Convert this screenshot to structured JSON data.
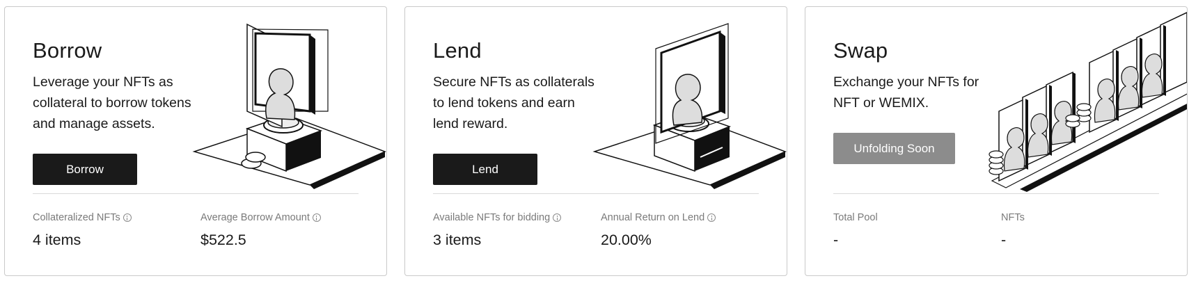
{
  "cards": [
    {
      "title": "Borrow",
      "description": "Leverage your NFTs as\ncollateral to borrow tokens\nand manage assets.",
      "button": "Borrow",
      "stats": [
        {
          "label": "Collateralized NFTs",
          "value": "4 items",
          "info_icon": "info-icon"
        },
        {
          "label": "Average Borrow Amount",
          "value": "$522.5",
          "info_icon": "info-icon"
        }
      ],
      "illustration": "nft-frame-pedestal-illustration"
    },
    {
      "title": "Lend",
      "description": "Secure NFTs as collaterals\nto lend tokens and earn\nlend reward.",
      "button": "Lend",
      "stats": [
        {
          "label": "Available NFTs for bidding",
          "value": "3 items",
          "info_icon": "info-icon"
        },
        {
          "label": "Annual Return on Lend",
          "value": "20.00%",
          "info_icon": "info-icon"
        }
      ],
      "illustration": "nft-frame-box-illustration"
    },
    {
      "title": "Swap",
      "description": "Exchange your NFTs for\nNFT or WEMIX.",
      "button": "Unfolding Soon",
      "button_disabled": true,
      "stats": [
        {
          "label": "Total Pool",
          "value": "-"
        },
        {
          "label": "NFTs",
          "value": "-"
        }
      ],
      "illustration": "nft-conveyor-illustration"
    }
  ],
  "colors": {
    "button_bg": "#1a1a1a",
    "button_disabled_bg": "#8c8c8c",
    "label_gray": "#7a7a7a",
    "border": "#c9c9c9"
  }
}
